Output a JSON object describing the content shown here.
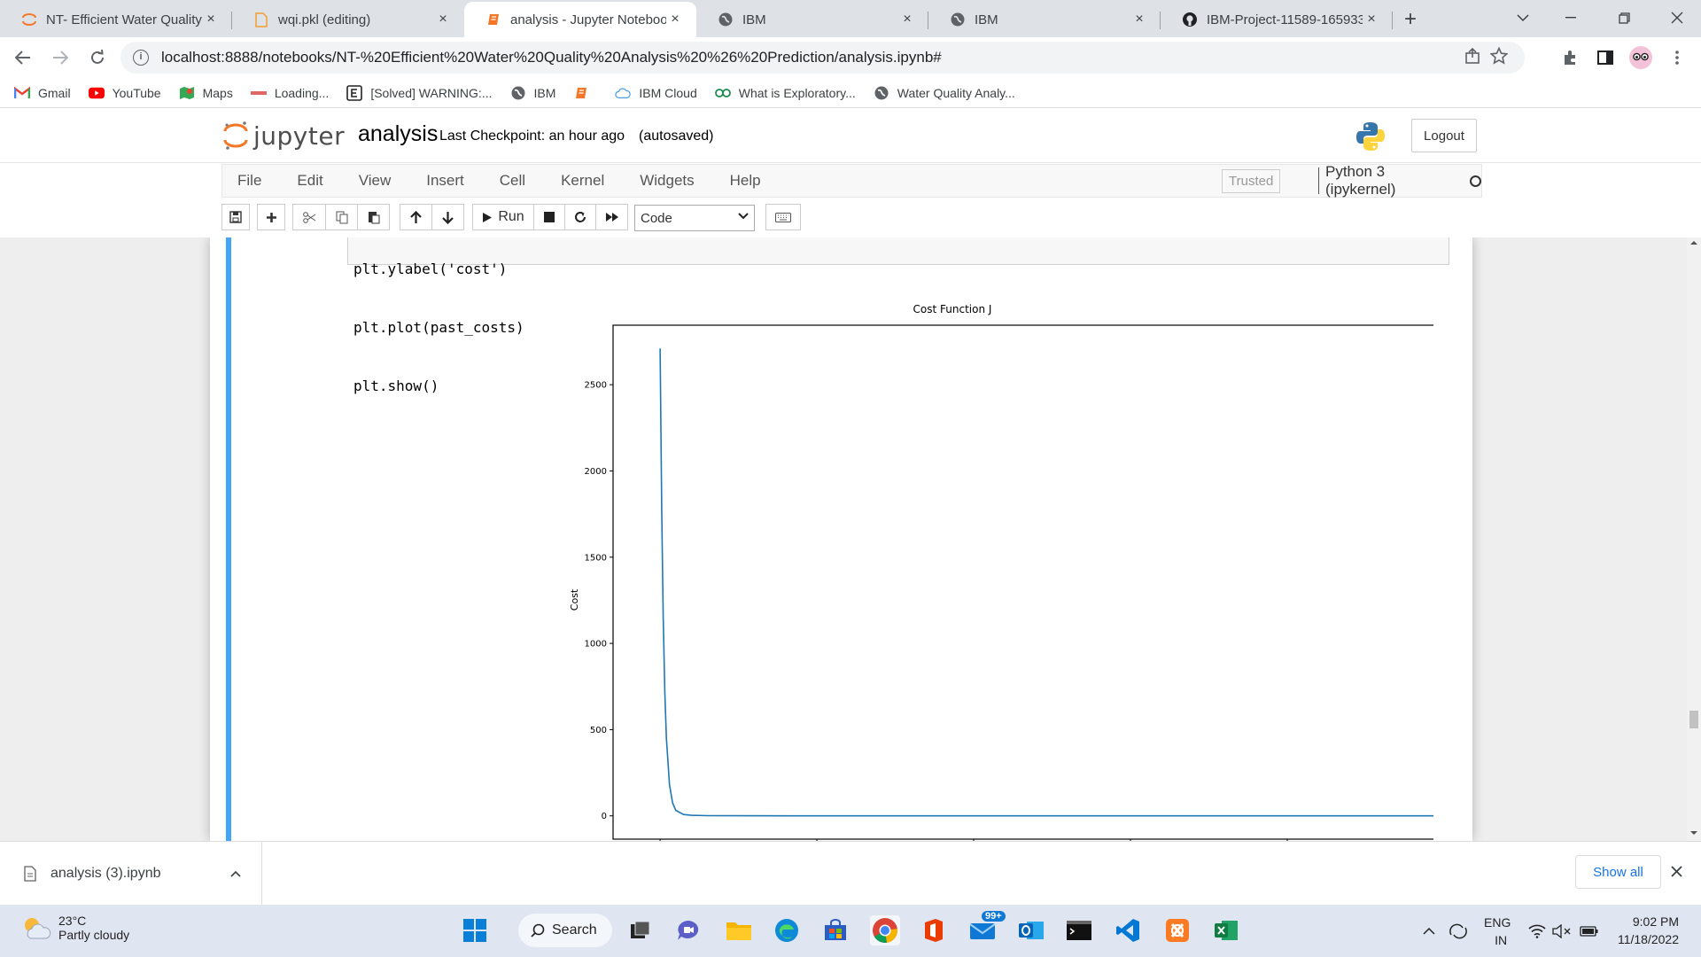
{
  "browser": {
    "tabs": [
      {
        "title": "NT- Efficient Water Quality",
        "icon": "jupyter-icon",
        "active": false
      },
      {
        "title": "wqi.pkl (editing)",
        "icon": "file-icon",
        "active": false
      },
      {
        "title": "analysis - Jupyter Noteboo",
        "icon": "notebook-icon",
        "active": true
      },
      {
        "title": "IBM",
        "icon": "globe-icon",
        "active": false
      },
      {
        "title": "IBM",
        "icon": "globe-icon",
        "active": false
      },
      {
        "title": "IBM-Project-11589-165933",
        "icon": "github-icon",
        "active": false
      }
    ],
    "close_glyph": "×",
    "new_tab_glyph": "+",
    "url": "localhost:8888/notebooks/NT-%20Efficient%20Water%20Quality%20Analysis%20%26%20Prediction/analysis.ipynb#",
    "bookmarks": [
      {
        "label": "Gmail",
        "icon": "gmail-icon"
      },
      {
        "label": "YouTube",
        "icon": "youtube-icon"
      },
      {
        "label": "Maps",
        "icon": "maps-icon"
      },
      {
        "label": "Loading...",
        "icon": "loading-icon"
      },
      {
        "label": "[Solved] WARNING:...",
        "icon": "e-icon"
      },
      {
        "label": "IBM",
        "icon": "globe-icon"
      },
      {
        "label": "",
        "icon": "notebook-icon"
      },
      {
        "label": "IBM Cloud",
        "icon": "cloud-icon"
      },
      {
        "label": "What is Exploratory...",
        "icon": "ae-icon"
      },
      {
        "label": "Water Quality Analy...",
        "icon": "globe-icon"
      }
    ]
  },
  "jupyter": {
    "logo_text": "jupyter",
    "notebook_name": "analysis",
    "checkpoint": "Last Checkpoint: an hour ago",
    "autosaved": "(autosaved)",
    "logout": "Logout",
    "menu": [
      "File",
      "Edit",
      "View",
      "Insert",
      "Cell",
      "Kernel",
      "Widgets",
      "Help"
    ],
    "trusted": "Trusted",
    "kernel": "Python 3 (ipykernel)",
    "run_label": "Run",
    "cell_type": "Code"
  },
  "cell": {
    "code_lines": [
      "plt.ylabel('cost')",
      "plt.plot(past_costs)",
      "plt.show()"
    ]
  },
  "chart_data": {
    "type": "line",
    "title": "Cost Function J",
    "ylabel": "Cost",
    "xlabel": "",
    "yticks": [
      0,
      500,
      1000,
      1500,
      2000,
      2500
    ],
    "ylim": [
      -135,
      2845
    ],
    "xlim": [
      -300,
      6300
    ],
    "grid": false,
    "series": [
      {
        "color": "#1f77b4",
        "x": [
          0,
          5,
          10,
          20,
          30,
          40,
          60,
          80,
          100,
          150,
          200,
          300,
          500,
          1000,
          2000,
          3000,
          4000,
          5000,
          6000
        ],
        "y": [
          2710,
          2250,
          1780,
          1150,
          720,
          450,
          180,
          75,
          32,
          8,
          3,
          1,
          0.5,
          0.3,
          0.2,
          0.2,
          0.2,
          0.2,
          0.2
        ]
      }
    ]
  },
  "downloads": {
    "file": "analysis (3).ipynb",
    "show_all": "Show all"
  },
  "taskbar": {
    "temperature": "23°C",
    "weather": "Partly cloudy",
    "search": "Search",
    "mail_badge": "99+",
    "lang_top": "ENG",
    "lang_bottom": "IN",
    "time": "9:02 PM",
    "date": "11/18/2022"
  }
}
